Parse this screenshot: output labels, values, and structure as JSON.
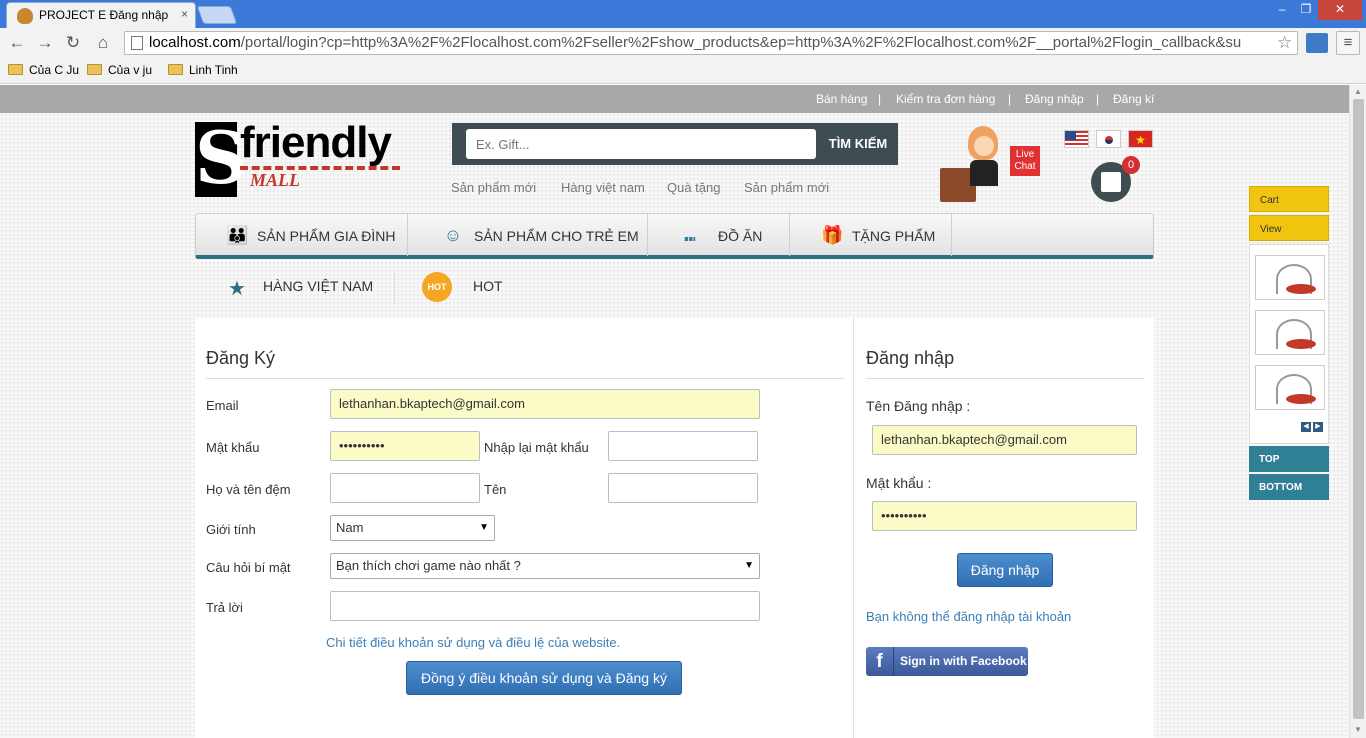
{
  "browser": {
    "tab_title": "PROJECT E Đăng nhập",
    "tab_close": "×",
    "win_min": "–",
    "win_max": "❐",
    "win_close": "✕",
    "url_host": "localhost.com",
    "url_path": "/portal/login?cp=http%3A%2F%2Flocalhost.com%2Fseller%2Fshow_products&ep=http%3A%2F%2Flocalhost.com%2F__portal%2Flogin_callback&su",
    "back": "←",
    "forward": "→",
    "reload": "↻",
    "home": "⌂",
    "star": "☆",
    "menu": "≡",
    "bookmarks": [
      "Của C Ju",
      "Của v ju",
      "Linh Tinh"
    ]
  },
  "topnav": {
    "items": [
      "Bán hàng",
      "Kiểm tra đơn hàng",
      "Đăng nhập",
      "Đăng kí"
    ],
    "separator": "|"
  },
  "logo": {
    "letter": "S",
    "text": "friendly",
    "sub": "MALL"
  },
  "search": {
    "placeholder": "Ex. Gift...",
    "button": "TÌM KIẾM"
  },
  "sublinks": [
    "Sản phẩm mới",
    "Hàng việt nam",
    "Quà tặng",
    "Sản phẩm mới"
  ],
  "livechat": {
    "label": "Live Chat"
  },
  "flags": {
    "vn_star": "★"
  },
  "cart": {
    "count": "0"
  },
  "categories": [
    {
      "label": "SẢN PHẨM GIA ĐÌNH",
      "icon": "👪"
    },
    {
      "label": "SẢN PHẨM CHO TRẺ EM",
      "icon": "☺"
    },
    {
      "label": "ĐỒ ĂN",
      "icon": "⑉"
    },
    {
      "label": "TẶNG PHẨM",
      "icon": "🎁"
    }
  ],
  "subcategories": [
    {
      "label": "HÀNG VIỆT NAM",
      "icon": "★"
    },
    {
      "label": "HOT",
      "icon": "HOT"
    }
  ],
  "register": {
    "title": "Đăng Ký",
    "email_label": "Email",
    "email_value": "lethanhan.bkaptech@gmail.com",
    "password_label": "Mật khẩu",
    "password_value": "••••••••••",
    "confirm_label": "Nhập lại mật khẩu",
    "confirm_value": "",
    "lastname_label": "Họ và tên đệm",
    "lastname_value": "",
    "firstname_label": "Tên",
    "firstname_value": "",
    "gender_label": "Giới tính",
    "gender_value": "Nam",
    "question_label": "Câu hỏi bí mật",
    "question_value": "Bạn thích chơi game nào nhất ?",
    "answer_label": "Trả lời",
    "answer_value": "",
    "terms_link": "Chi tiết điều khoản sử dụng và điều lệ của website.",
    "submit": "Đồng ý điều khoản sử dụng và Đăng ký",
    "dropdown_arrow": "▼"
  },
  "login": {
    "title": "Đăng nhập",
    "username_label": "Tên Đăng nhập :",
    "username_value": "lethanhan.bkaptech@gmail.com",
    "password_label": "Mật khẩu :",
    "password_value": "••••••••••",
    "submit": "Đăng nhập",
    "forgot_link": "Bạn không thể đăng nhập tài khoản",
    "facebook_icon": "f",
    "facebook_label": "Sign in with Facebook"
  },
  "floating": {
    "cart": "Cart",
    "view": "View",
    "prev": "◀",
    "next": "▶",
    "top": "TOP",
    "bottom": "BOTTOM"
  },
  "scrollbar": {
    "up": "▲",
    "down": "▼"
  }
}
